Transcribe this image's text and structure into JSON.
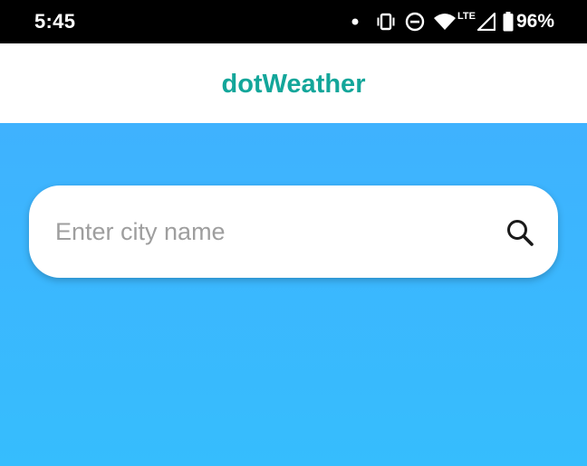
{
  "status_bar": {
    "time": "5:45",
    "network_label": "LTE",
    "battery": "96%",
    "icons": [
      "notification-dot-icon",
      "vibrate-icon",
      "do-not-disturb-icon",
      "wifi-icon",
      "cellular-signal-icon",
      "battery-icon"
    ]
  },
  "app_bar": {
    "title": "dotWeather",
    "title_color": "#13a69a"
  },
  "search": {
    "placeholder": "Enter city name",
    "value": "",
    "icon": "search-icon"
  },
  "colors": {
    "background": "#3ab7fd",
    "accent": "#13a69a"
  }
}
